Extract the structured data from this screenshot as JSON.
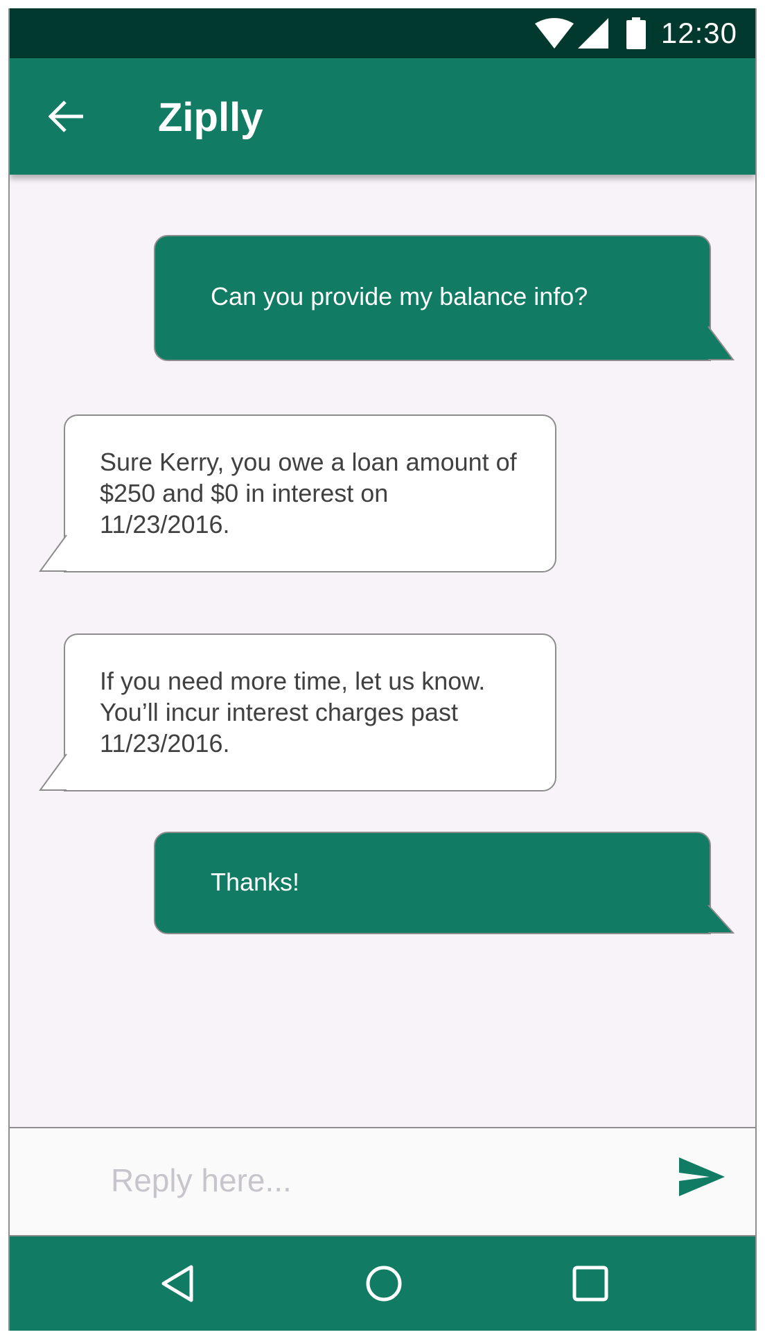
{
  "status_bar": {
    "time": "12:30",
    "icons": [
      "wifi-icon",
      "cellular-signal-icon",
      "battery-icon"
    ]
  },
  "app_bar": {
    "title": "Ziplly",
    "back_icon": "arrow-back-icon"
  },
  "messages": [
    {
      "direction": "outgoing",
      "lines": [
        "Can you provide my balance info?"
      ]
    },
    {
      "direction": "incoming",
      "lines": [
        "Sure Kerry, you owe a loan amount of",
        "$250 and $0 in interest on",
        "11/23/2016."
      ]
    },
    {
      "direction": "incoming",
      "lines": [
        "If you need more time, let us know.",
        "You’ll incur interest charges past",
        "11/23/2016."
      ]
    },
    {
      "direction": "outgoing",
      "lines": [
        "Thanks!"
      ]
    }
  ],
  "reply": {
    "placeholder": "Reply here...",
    "value": "",
    "send_icon": "send-icon"
  },
  "nav_bar": {
    "icons": [
      "nav-back-icon",
      "nav-home-icon",
      "nav-recents-icon"
    ]
  },
  "colors": {
    "status_bar": "#02392e",
    "primary": "#117b63",
    "background": "#f7f3f9",
    "incoming_bubble": "#ffffff",
    "incoming_text": "#404040",
    "placeholder": "#c8c4cc"
  }
}
